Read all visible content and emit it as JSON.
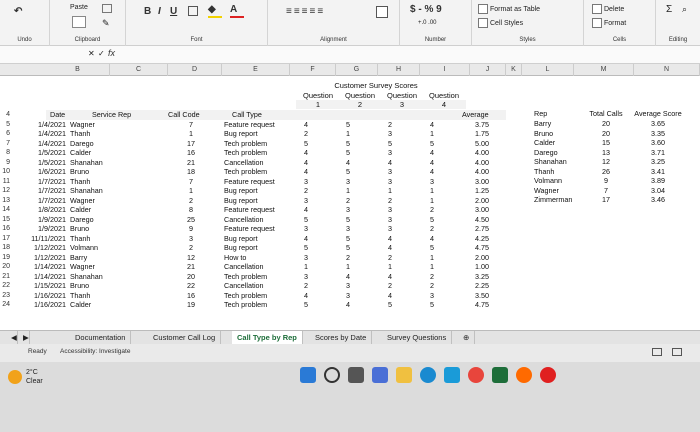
{
  "ribbon": {
    "undo_label": "Undo",
    "clipboard_label": "Clipboard",
    "paste_label": "Paste",
    "font_label": "Font",
    "font_buttons": [
      "B",
      "I",
      "U"
    ],
    "alignment_label": "Alignment",
    "number_label": "Number",
    "number_symbols": "$ - % 9",
    "format_as_table": "Format as Table",
    "cell_styles": "Cell Styles",
    "styles_label": "Styles",
    "delete_label": "Delete",
    "format_label": "Format",
    "cells_label": "Cells",
    "editing_label": "Editing"
  },
  "formula_bar": {
    "fx": "fx"
  },
  "columns": [
    "B",
    "C",
    "D",
    "E",
    "F",
    "G",
    "H",
    "I",
    "J",
    "K",
    "L",
    "M",
    "N"
  ],
  "survey": {
    "title": "Customer Survey Scores",
    "question_labels": [
      "Question",
      "Question",
      "Question",
      "Question"
    ],
    "question_numbers": [
      "1",
      "2",
      "3",
      "4"
    ]
  },
  "table_headers": {
    "date": "Date",
    "rep": "Service Rep",
    "code": "Call Code",
    "type": "Call Type",
    "average": "Average"
  },
  "rows": [
    {
      "n": "4"
    },
    {
      "n": "5",
      "date": "1/4/2021",
      "rep": "Wagner",
      "code": "7",
      "type": "Feature request",
      "q1": "4",
      "q2": "5",
      "q3": "2",
      "q4": "4",
      "avg": "3.75"
    },
    {
      "n": "6",
      "date": "1/4/2021",
      "rep": "Thanh",
      "code": "1",
      "type": "Bug report",
      "q1": "2",
      "q2": "1",
      "q3": "3",
      "q4": "1",
      "avg": "1.75"
    },
    {
      "n": "7",
      "date": "1/4/2021",
      "rep": "Darego",
      "code": "17",
      "type": "Tech problem",
      "q1": "5",
      "q2": "5",
      "q3": "5",
      "q4": "5",
      "avg": "5.00"
    },
    {
      "n": "8",
      "date": "1/5/2021",
      "rep": "Calder",
      "code": "16",
      "type": "Tech problem",
      "q1": "4",
      "q2": "5",
      "q3": "3",
      "q4": "4",
      "avg": "4.00"
    },
    {
      "n": "9",
      "date": "1/5/2021",
      "rep": "Shanahan",
      "code": "21",
      "type": "Cancellation",
      "q1": "4",
      "q2": "4",
      "q3": "4",
      "q4": "4",
      "avg": "4.00"
    },
    {
      "n": "10",
      "date": "1/6/2021",
      "rep": "Bruno",
      "code": "18",
      "type": "Tech problem",
      "q1": "4",
      "q2": "5",
      "q3": "3",
      "q4": "4",
      "avg": "4.00"
    },
    {
      "n": "11",
      "date": "1/7/2021",
      "rep": "Thanh",
      "code": "7",
      "type": "Feature request",
      "q1": "3",
      "q2": "3",
      "q3": "3",
      "q4": "3",
      "avg": "3.00"
    },
    {
      "n": "12",
      "date": "1/7/2021",
      "rep": "Shanahan",
      "code": "1",
      "type": "Bug report",
      "q1": "2",
      "q2": "1",
      "q3": "1",
      "q4": "1",
      "avg": "1.25"
    },
    {
      "n": "13",
      "date": "1/7/2021",
      "rep": "Wagner",
      "code": "2",
      "type": "Bug report",
      "q1": "3",
      "q2": "2",
      "q3": "2",
      "q4": "1",
      "avg": "2.00"
    },
    {
      "n": "14",
      "date": "1/8/2021",
      "rep": "Calder",
      "code": "8",
      "type": "Feature request",
      "q1": "4",
      "q2": "3",
      "q3": "3",
      "q4": "2",
      "avg": "3.00"
    },
    {
      "n": "15",
      "date": "1/9/2021",
      "rep": "Darego",
      "code": "25",
      "type": "Cancellation",
      "q1": "5",
      "q2": "5",
      "q3": "3",
      "q4": "5",
      "avg": "4.50"
    },
    {
      "n": "16",
      "date": "1/9/2021",
      "rep": "Bruno",
      "code": "9",
      "type": "Feature request",
      "q1": "3",
      "q2": "3",
      "q3": "3",
      "q4": "2",
      "avg": "2.75"
    },
    {
      "n": "17",
      "date": "11/11/2021",
      "rep": "Thanh",
      "code": "3",
      "type": "Bug report",
      "q1": "4",
      "q2": "5",
      "q3": "4",
      "q4": "4",
      "avg": "4.25"
    },
    {
      "n": "18",
      "date": "1/12/2021",
      "rep": "Volmann",
      "code": "2",
      "type": "Bug report",
      "q1": "5",
      "q2": "5",
      "q3": "4",
      "q4": "5",
      "avg": "4.75"
    },
    {
      "n": "19",
      "date": "1/12/2021",
      "rep": "Barry",
      "code": "12",
      "type": "How to",
      "q1": "3",
      "q2": "2",
      "q3": "2",
      "q4": "1",
      "avg": "2.00"
    },
    {
      "n": "20",
      "date": "1/14/2021",
      "rep": "Wagner",
      "code": "21",
      "type": "Cancellation",
      "q1": "1",
      "q2": "1",
      "q3": "1",
      "q4": "1",
      "avg": "1.00"
    },
    {
      "n": "21",
      "date": "1/14/2021",
      "rep": "Shanahan",
      "code": "20",
      "type": "Tech problem",
      "q1": "3",
      "q2": "4",
      "q3": "4",
      "q4": "2",
      "avg": "3.25"
    },
    {
      "n": "22",
      "date": "1/15/2021",
      "rep": "Bruno",
      "code": "22",
      "type": "Cancellation",
      "q1": "2",
      "q2": "3",
      "q3": "2",
      "q4": "2",
      "avg": "2.25"
    },
    {
      "n": "23",
      "date": "1/16/2021",
      "rep": "Thanh",
      "code": "16",
      "type": "Tech problem",
      "q1": "4",
      "q2": "3",
      "q3": "4",
      "q4": "3",
      "avg": "3.50"
    },
    {
      "n": "24",
      "date": "1/16/2021",
      "rep": "Calder",
      "code": "19",
      "type": "Tech problem",
      "q1": "5",
      "q2": "4",
      "q3": "5",
      "q4": "5",
      "avg": "4.75"
    }
  ],
  "rep_summary": {
    "headers": [
      "Rep",
      "Total Calls",
      "Average Score"
    ],
    "rows": [
      {
        "rep": "Barry",
        "calls": "20",
        "avg": "3.65"
      },
      {
        "rep": "Bruno",
        "calls": "20",
        "avg": "3.35"
      },
      {
        "rep": "Calder",
        "calls": "15",
        "avg": "3.60"
      },
      {
        "rep": "Darego",
        "calls": "13",
        "avg": "3.71"
      },
      {
        "rep": "Shanahan",
        "calls": "12",
        "avg": "3.25"
      },
      {
        "rep": "Thanh",
        "calls": "26",
        "avg": "3.41"
      },
      {
        "rep": "Volmann",
        "calls": "9",
        "avg": "3.89"
      },
      {
        "rep": "Wagner",
        "calls": "7",
        "avg": "3.04"
      },
      {
        "rep": "Zimmerman",
        "calls": "17",
        "avg": "3.46"
      }
    ]
  },
  "tabs": [
    "Documentation",
    "Customer Call Log",
    "Call Type by Rep",
    "Scores by Date",
    "Survey Questions"
  ],
  "status": {
    "ready": "Ready",
    "accessibility": "Accessibility: Investigate"
  },
  "weather": {
    "temp": "2°C",
    "desc": "Clear"
  },
  "colors": {
    "excel_green": "#1e6e3a",
    "header_band": "#f2f2f2"
  }
}
